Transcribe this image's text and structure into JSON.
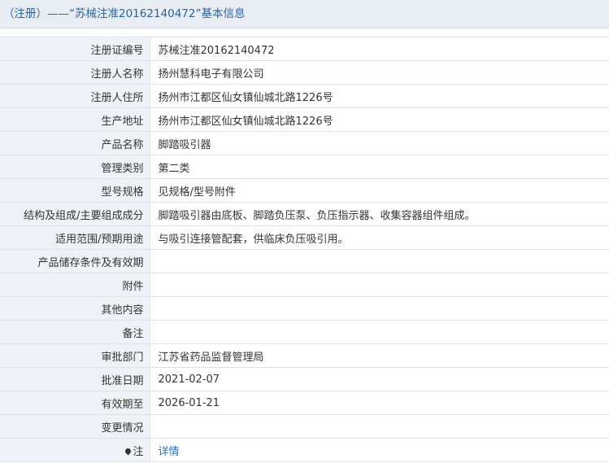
{
  "header": {
    "title": "（注册）——“苏械注准20162140472”基本信息"
  },
  "rows": [
    {
      "label": "注册证编号",
      "value": "苏械注准20162140472"
    },
    {
      "label": "注册人名称",
      "value": "扬州慧科电子有限公司"
    },
    {
      "label": "注册人住所",
      "value": "扬州市江都区仙女镇仙城北路1226号"
    },
    {
      "label": "生产地址",
      "value": "扬州市江都区仙女镇仙城北路1226号"
    },
    {
      "label": "产品名称",
      "value": "脚踏吸引器"
    },
    {
      "label": "管理类别",
      "value": "第二类"
    },
    {
      "label": "型号规格",
      "value": "见规格/型号附件"
    },
    {
      "label": "结构及组成/主要组成成分",
      "value": "脚踏吸引器由底板、脚踏负压泵、负压指示器、收集容器组件组成。"
    },
    {
      "label": "适用范围/预期用途",
      "value": "与吸引连接管配套，供临床负压吸引用。"
    },
    {
      "label": "产品储存条件及有效期",
      "value": ""
    },
    {
      "label": "附件",
      "value": ""
    },
    {
      "label": "其他内容",
      "value": ""
    },
    {
      "label": "备注",
      "value": ""
    },
    {
      "label": "审批部门",
      "value": "江苏省药品监督管理局"
    },
    {
      "label": "批准日期",
      "value": "2021-02-07"
    },
    {
      "label": "有效期至",
      "value": "2026-01-21"
    },
    {
      "label": "变更情况",
      "value": ""
    }
  ],
  "note_row": {
    "label": "注",
    "icon": "pin-icon",
    "link_text": "详情"
  }
}
